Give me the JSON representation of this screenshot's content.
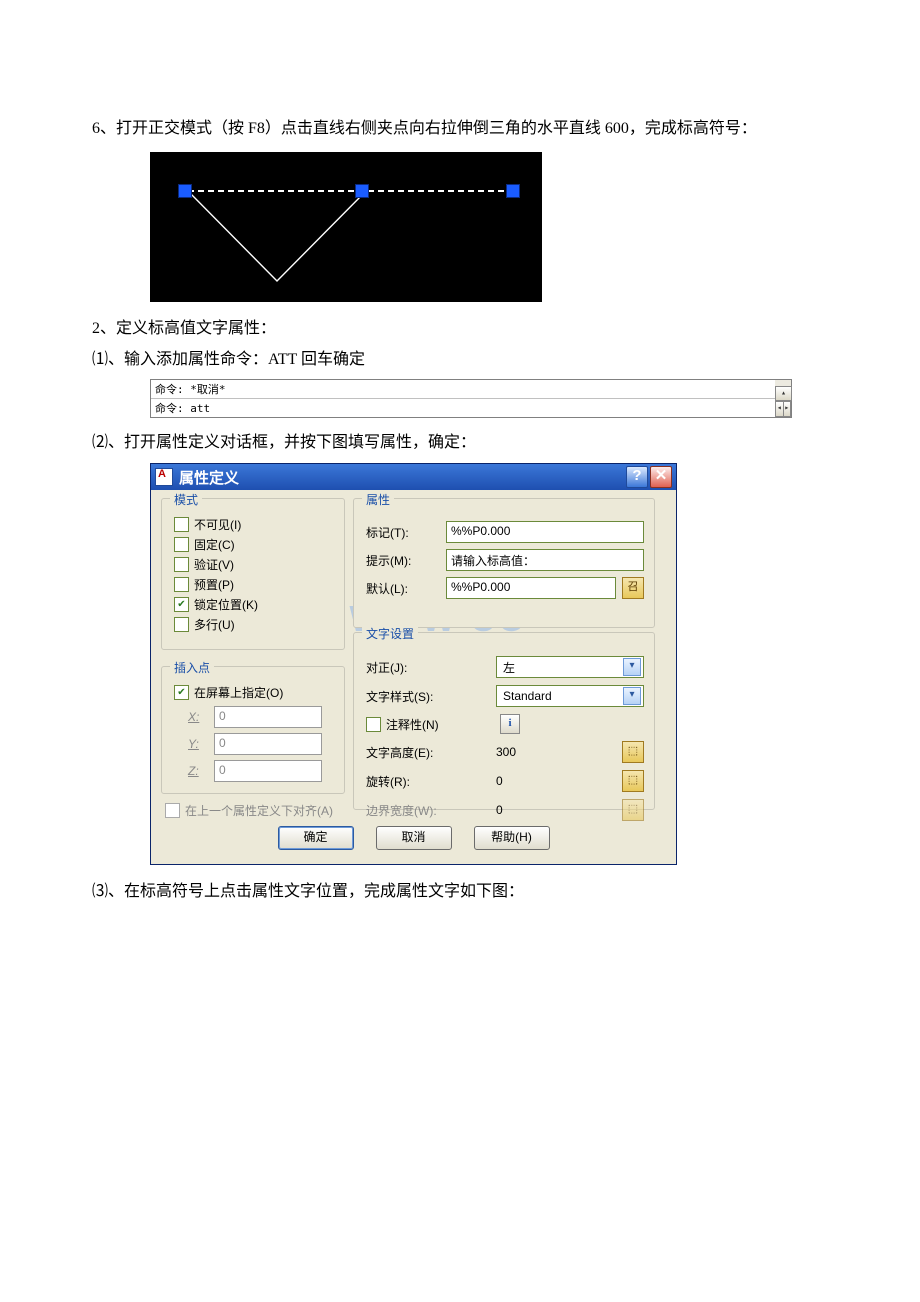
{
  "para1": "6、打开正交模式（按 F8）点击直线右侧夹点向右拉伸倒三角的水平直线 600，完成标高符号：",
  "para2": "2、定义标高值文字属性：",
  "para3": "⑴、输入添加属性命令：ATT 回车确定",
  "para4": "⑵、打开属性定义对话框，并按下图填写属性，确定：",
  "para5": "⑶、在标高符号上点击属性文字位置，完成属性文字如下图：",
  "cmd": {
    "line1": "命令: *取消*",
    "line2": "命令: att"
  },
  "watermark": "WWW                 CO",
  "dialog": {
    "title": "属性定义",
    "groups": {
      "mode": "模式",
      "insert": "插入点",
      "attr": "属性",
      "text": "文字设置"
    },
    "mode": {
      "invisible": "不可见(I)",
      "fixed": "固定(C)",
      "verify": "验证(V)",
      "preset": "预置(P)",
      "lock": "锁定位置(K)",
      "multi": "多行(U)"
    },
    "insert": {
      "onscreen": "在屏幕上指定(O)",
      "x_label": "X:",
      "y_label": "Y:",
      "z_label": "Z:",
      "x": "0",
      "y": "0",
      "z": "0"
    },
    "attr": {
      "tag_label": "标记(T):",
      "tag": "%%P0.000",
      "prompt_label": "提示(M):",
      "prompt": "请输入标高值：",
      "default_label": "默认(L):",
      "default": "%%P0.000"
    },
    "text": {
      "justify_label": "对正(J):",
      "justify": "左",
      "style_label": "文字样式(S):",
      "style": "Standard",
      "annotative": "注释性(N)",
      "height_label": "文字高度(E):",
      "height": "300",
      "rotate_label": "旋转(R):",
      "rotate": "0",
      "width_label": "边界宽度(W):",
      "width": "0"
    },
    "align_prev": "在上一个属性定义下对齐(A)",
    "buttons": {
      "ok": "确定",
      "cancel": "取消",
      "help": "帮助(H)"
    }
  }
}
